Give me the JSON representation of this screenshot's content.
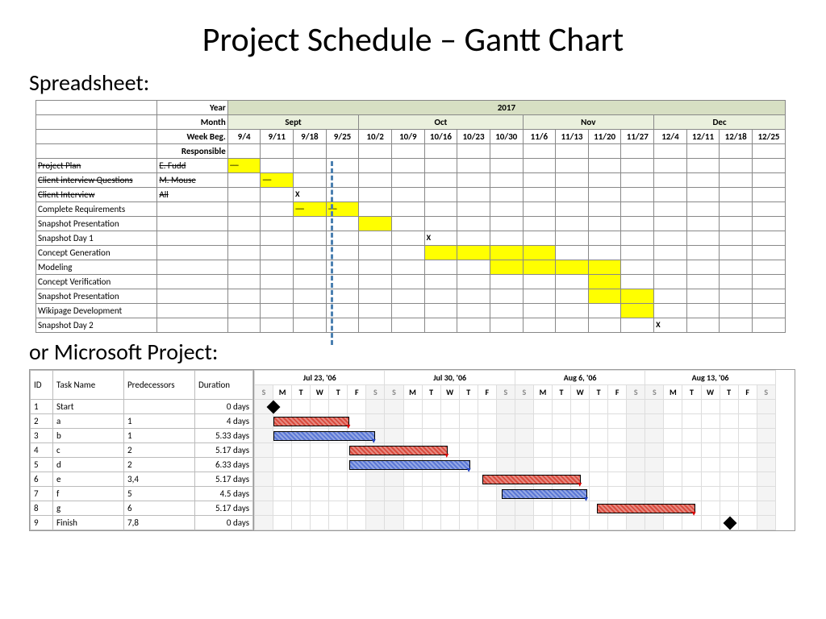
{
  "title": "Project Schedule – Gantt Chart",
  "labels": {
    "spreadsheet": "Spreadsheet:",
    "msproject": "or Microsoft Project:"
  },
  "spreadsheet": {
    "year_label": "Year",
    "year_value": "2017",
    "month_label": "Month",
    "months": [
      {
        "name": "Sept",
        "span": 4
      },
      {
        "name": "Oct",
        "span": 5
      },
      {
        "name": "Nov",
        "span": 4
      },
      {
        "name": "Dec",
        "span": 4
      }
    ],
    "week_label": "Week Beg.",
    "weeks": [
      "9/4",
      "9/11",
      "9/18",
      "9/25",
      "10/2",
      "10/9",
      "10/16",
      "10/23",
      "10/30",
      "11/6",
      "11/13",
      "11/20",
      "11/27",
      "12/4",
      "12/11",
      "12/18",
      "12/25"
    ],
    "responsible_label": "Responsible",
    "today_index": 3,
    "rows": [
      {
        "task": "Project Plan",
        "responsible": "E. Fudd",
        "strike": true,
        "bars": [
          0
        ],
        "x": []
      },
      {
        "task": "Client interview Questions",
        "responsible": "M. Mouse",
        "strike": true,
        "bars": [
          1
        ],
        "x": []
      },
      {
        "task": "Client Interview",
        "responsible": "All",
        "strike": true,
        "bars": [],
        "x": [
          2
        ]
      },
      {
        "task": "Complete Requirements",
        "responsible": "",
        "strike": false,
        "bars": [
          2,
          3
        ],
        "x": []
      },
      {
        "task": "Snapshot Presentation",
        "responsible": "",
        "strike": false,
        "bars": [
          4
        ],
        "x": []
      },
      {
        "task": "Snapshot Day 1",
        "responsible": "",
        "strike": false,
        "bars": [],
        "x": [
          6
        ]
      },
      {
        "task": "Concept Generation",
        "responsible": "",
        "strike": false,
        "bars": [
          6,
          7,
          8,
          9
        ],
        "x": []
      },
      {
        "task": "Modeling",
        "responsible": "",
        "strike": false,
        "bars": [
          8,
          9,
          10,
          11
        ],
        "x": []
      },
      {
        "task": "Concept Verification",
        "responsible": "",
        "strike": false,
        "bars": [
          11
        ],
        "x": []
      },
      {
        "task": "Snapshot Presentation",
        "responsible": "",
        "strike": false,
        "bars": [
          11,
          12
        ],
        "x": []
      },
      {
        "task": "Wikipage Development",
        "responsible": "",
        "strike": false,
        "bars": [
          12
        ],
        "x": []
      },
      {
        "task": "Snapshot Day 2",
        "responsible": "",
        "strike": false,
        "bars": [],
        "x": [
          13
        ]
      }
    ]
  },
  "msproject": {
    "columns": [
      "ID",
      "Task Name",
      "Predecessors",
      "Duration"
    ],
    "date_groups": [
      "Jul 23, '06",
      "Jul 30, '06",
      "Aug 6, '06",
      "Aug 13, '06"
    ],
    "day_letters": [
      "S",
      "M",
      "T",
      "W",
      "T",
      "F",
      "S"
    ],
    "rows": [
      {
        "id": "1",
        "name": "Start",
        "pred": "",
        "dur": "0 days"
      },
      {
        "id": "2",
        "name": "a",
        "pred": "1",
        "dur": "4 days"
      },
      {
        "id": "3",
        "name": "b",
        "pred": "1",
        "dur": "5.33 days"
      },
      {
        "id": "4",
        "name": "c",
        "pred": "2",
        "dur": "5.17 days"
      },
      {
        "id": "5",
        "name": "d",
        "pred": "2",
        "dur": "6.33 days"
      },
      {
        "id": "6",
        "name": "e",
        "pred": "3,4",
        "dur": "5.17 days"
      },
      {
        "id": "7",
        "name": "f",
        "pred": "5",
        "dur": "4.5 days"
      },
      {
        "id": "8",
        "name": "g",
        "pred": "6",
        "dur": "5.17 days"
      },
      {
        "id": "9",
        "name": "Finish",
        "pred": "7,8",
        "dur": "0 days"
      }
    ]
  },
  "chart_data": [
    {
      "type": "gantt",
      "title": "Project Schedule Spreadsheet (2017)",
      "x_unit": "week_beginning",
      "categories": [
        "9/4",
        "9/11",
        "9/18",
        "9/25",
        "10/2",
        "10/9",
        "10/16",
        "10/23",
        "10/30",
        "11/6",
        "11/13",
        "11/20",
        "11/27",
        "12/4",
        "12/11",
        "12/18",
        "12/25"
      ],
      "today_marker_index": 3,
      "tasks": [
        {
          "name": "Project Plan",
          "owner": "E. Fudd",
          "done": true,
          "span": [
            0,
            0
          ]
        },
        {
          "name": "Client interview Questions",
          "owner": "M. Mouse",
          "done": true,
          "span": [
            1,
            1
          ]
        },
        {
          "name": "Client Interview",
          "owner": "All",
          "done": true,
          "milestone_at": 2
        },
        {
          "name": "Complete Requirements",
          "owner": "",
          "done": false,
          "span": [
            2,
            3
          ]
        },
        {
          "name": "Snapshot Presentation",
          "owner": "",
          "done": false,
          "span": [
            4,
            4
          ]
        },
        {
          "name": "Snapshot Day 1",
          "owner": "",
          "done": false,
          "milestone_at": 6
        },
        {
          "name": "Concept Generation",
          "owner": "",
          "done": false,
          "span": [
            6,
            9
          ]
        },
        {
          "name": "Modeling",
          "owner": "",
          "done": false,
          "span": [
            8,
            11
          ]
        },
        {
          "name": "Concept Verification",
          "owner": "",
          "done": false,
          "span": [
            11,
            11
          ]
        },
        {
          "name": "Snapshot Presentation",
          "owner": "",
          "done": false,
          "span": [
            11,
            12
          ]
        },
        {
          "name": "Wikipage Development",
          "owner": "",
          "done": false,
          "span": [
            12,
            12
          ]
        },
        {
          "name": "Snapshot Day 2",
          "owner": "",
          "done": false,
          "milestone_at": 13
        }
      ]
    },
    {
      "type": "gantt",
      "title": "Microsoft Project Schedule",
      "start_date": "2006-07-23",
      "x_unit": "day",
      "columns_per_week": 7,
      "weeks_shown": 4,
      "tasks": [
        {
          "id": 1,
          "name": "Start",
          "pred": [],
          "duration_days": 0,
          "start_day_index": 1,
          "milestone": true
        },
        {
          "id": 2,
          "name": "a",
          "pred": [
            1
          ],
          "duration_days": 4,
          "start_day_index": 1,
          "critical": true
        },
        {
          "id": 3,
          "name": "b",
          "pred": [
            1
          ],
          "duration_days": 5.33,
          "start_day_index": 1,
          "critical": false
        },
        {
          "id": 4,
          "name": "c",
          "pred": [
            2
          ],
          "duration_days": 5.17,
          "start_day_index": 5,
          "critical": true
        },
        {
          "id": 5,
          "name": "d",
          "pred": [
            2
          ],
          "duration_days": 6.33,
          "start_day_index": 5,
          "critical": false
        },
        {
          "id": 6,
          "name": "e",
          "pred": [
            3,
            4
          ],
          "duration_days": 5.17,
          "start_day_index": 12,
          "critical": true
        },
        {
          "id": 7,
          "name": "f",
          "pred": [
            5
          ],
          "duration_days": 4.5,
          "start_day_index": 13,
          "critical": false
        },
        {
          "id": 8,
          "name": "g",
          "pred": [
            6
          ],
          "duration_days": 5.17,
          "start_day_index": 18,
          "critical": true
        },
        {
          "id": 9,
          "name": "Finish",
          "pred": [
            7,
            8
          ],
          "duration_days": 0,
          "start_day_index": 25,
          "milestone": true
        }
      ]
    }
  ]
}
